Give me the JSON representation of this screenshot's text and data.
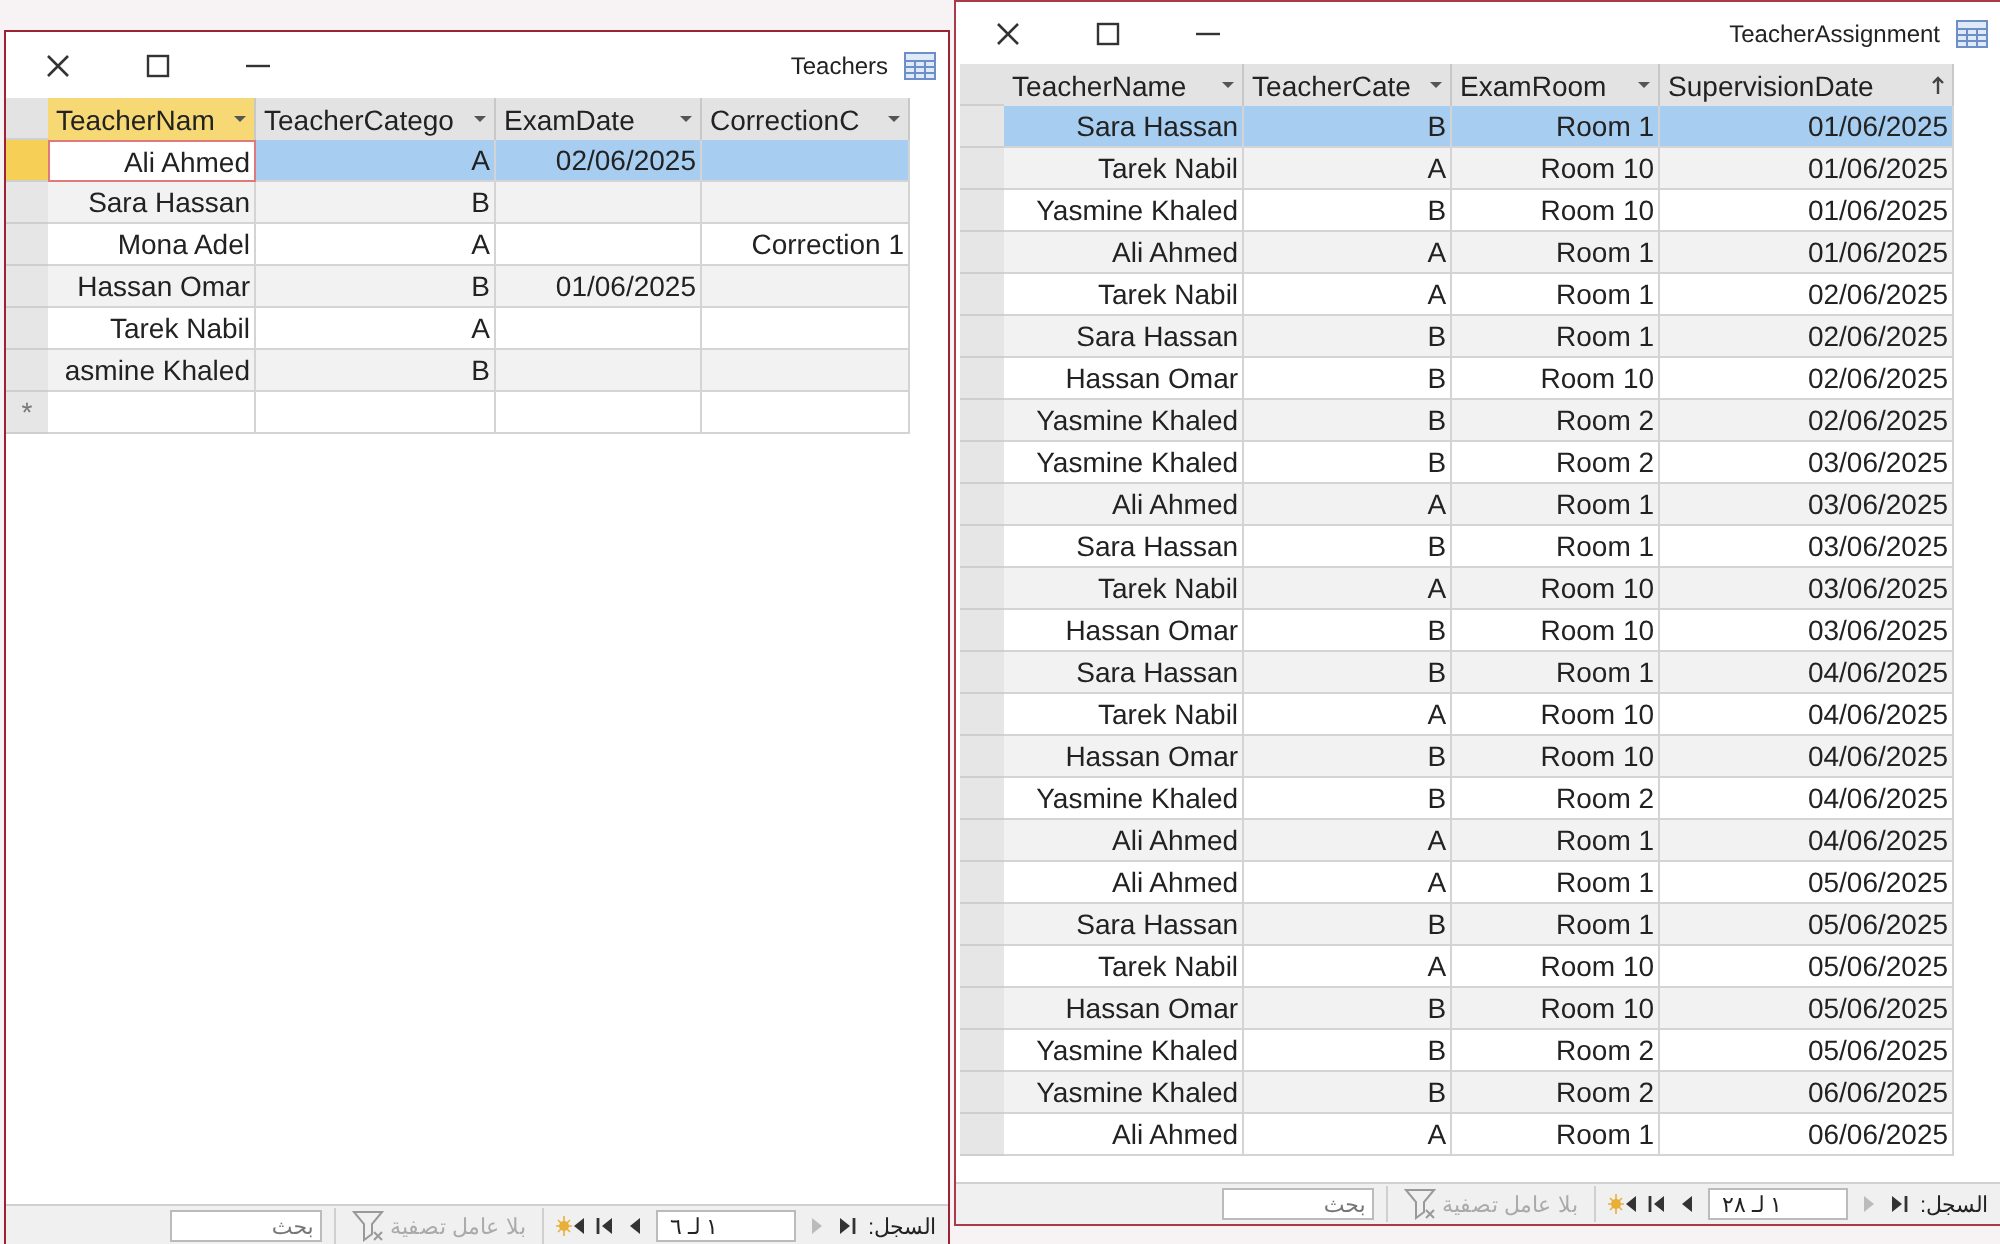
{
  "windows": [
    {
      "title": "Teachers",
      "active": true,
      "columns": [
        {
          "label": "TeacherNam",
          "sorted": false,
          "selected": true
        },
        {
          "label": "TeacherCatego",
          "sorted": false,
          "selected": false
        },
        {
          "label": "ExamDate",
          "sorted": false,
          "selected": false
        },
        {
          "label": "CorrectionC",
          "sorted": false,
          "selected": false
        }
      ],
      "rows": [
        {
          "selected": true,
          "cells": [
            "Ali Ahmed",
            "A",
            "02/06/2025",
            null
          ]
        },
        {
          "selected": false,
          "cells": [
            "Sara Hassan",
            "B",
            null,
            null
          ]
        },
        {
          "selected": false,
          "cells": [
            "Mona Adel",
            "A",
            null,
            "Correction 1"
          ]
        },
        {
          "selected": false,
          "cells": [
            "Hassan Omar",
            "B",
            "01/06/2025",
            null
          ]
        },
        {
          "selected": false,
          "cells": [
            "Tarek Nabil",
            "A",
            null,
            null
          ]
        },
        {
          "selected": false,
          "cells": [
            "asmine Khaled",
            "B",
            null,
            null
          ]
        }
      ],
      "new_row_marker": "*",
      "status_bar": {
        "label": "السجل:",
        "record": "١ لـ ٦",
        "filter": "بلا عامل تصفية",
        "search_placeholder": "بحث"
      }
    },
    {
      "title": "TeacherAssignment",
      "active": false,
      "columns": [
        {
          "label": "TeacherName",
          "sorted": false,
          "selected": false
        },
        {
          "label": "TeacherCate",
          "sorted": false,
          "selected": false
        },
        {
          "label": "ExamRoom",
          "sorted": false,
          "selected": false
        },
        {
          "label": "SupervisionDate",
          "sorted": true,
          "selected": false
        }
      ],
      "rows": [
        {
          "selected": true,
          "cells": [
            "Sara Hassan",
            "B",
            "Room 1",
            "01/06/2025"
          ]
        },
        {
          "selected": false,
          "cells": [
            "Tarek Nabil",
            "A",
            "Room 10",
            "01/06/2025"
          ]
        },
        {
          "selected": false,
          "cells": [
            "Yasmine Khaled",
            "B",
            "Room 10",
            "01/06/2025"
          ]
        },
        {
          "selected": false,
          "cells": [
            "Ali Ahmed",
            "A",
            "Room 1",
            "01/06/2025"
          ]
        },
        {
          "selected": false,
          "cells": [
            "Tarek Nabil",
            "A",
            "Room 1",
            "02/06/2025"
          ]
        },
        {
          "selected": false,
          "cells": [
            "Sara Hassan",
            "B",
            "Room 1",
            "02/06/2025"
          ]
        },
        {
          "selected": false,
          "cells": [
            "Hassan Omar",
            "B",
            "Room 10",
            "02/06/2025"
          ]
        },
        {
          "selected": false,
          "cells": [
            "Yasmine Khaled",
            "B",
            "Room 2",
            "02/06/2025"
          ]
        },
        {
          "selected": false,
          "cells": [
            "Yasmine Khaled",
            "B",
            "Room 2",
            "03/06/2025"
          ]
        },
        {
          "selected": false,
          "cells": [
            "Ali Ahmed",
            "A",
            "Room 1",
            "03/06/2025"
          ]
        },
        {
          "selected": false,
          "cells": [
            "Sara Hassan",
            "B",
            "Room 1",
            "03/06/2025"
          ]
        },
        {
          "selected": false,
          "cells": [
            "Tarek Nabil",
            "A",
            "Room 10",
            "03/06/2025"
          ]
        },
        {
          "selected": false,
          "cells": [
            "Hassan Omar",
            "B",
            "Room 10",
            "03/06/2025"
          ]
        },
        {
          "selected": false,
          "cells": [
            "Sara Hassan",
            "B",
            "Room 1",
            "04/06/2025"
          ]
        },
        {
          "selected": false,
          "cells": [
            "Tarek Nabil",
            "A",
            "Room 10",
            "04/06/2025"
          ]
        },
        {
          "selected": false,
          "cells": [
            "Hassan Omar",
            "B",
            "Room 10",
            "04/06/2025"
          ]
        },
        {
          "selected": false,
          "cells": [
            "Yasmine Khaled",
            "B",
            "Room 2",
            "04/06/2025"
          ]
        },
        {
          "selected": false,
          "cells": [
            "Ali Ahmed",
            "A",
            "Room 1",
            "04/06/2025"
          ]
        },
        {
          "selected": false,
          "cells": [
            "Ali Ahmed",
            "A",
            "Room 1",
            "05/06/2025"
          ]
        },
        {
          "selected": false,
          "cells": [
            "Sara Hassan",
            "B",
            "Room 1",
            "05/06/2025"
          ]
        },
        {
          "selected": false,
          "cells": [
            "Tarek Nabil",
            "A",
            "Room 10",
            "05/06/2025"
          ]
        },
        {
          "selected": false,
          "cells": [
            "Hassan Omar",
            "B",
            "Room 10",
            "05/06/2025"
          ]
        },
        {
          "selected": false,
          "cells": [
            "Yasmine Khaled",
            "B",
            "Room 2",
            "05/06/2025"
          ]
        },
        {
          "selected": false,
          "cells": [
            "Yasmine Khaled",
            "B",
            "Room 2",
            "06/06/2025"
          ]
        },
        {
          "selected": false,
          "cells": [
            "Ali Ahmed",
            "A",
            "Room 1",
            "06/06/2025"
          ]
        }
      ],
      "status_bar": {
        "label": "السجل:",
        "record": "١ لـ ٢٨",
        "filter": "بلا عامل تصفية",
        "search_placeholder": "بحث"
      }
    }
  ]
}
